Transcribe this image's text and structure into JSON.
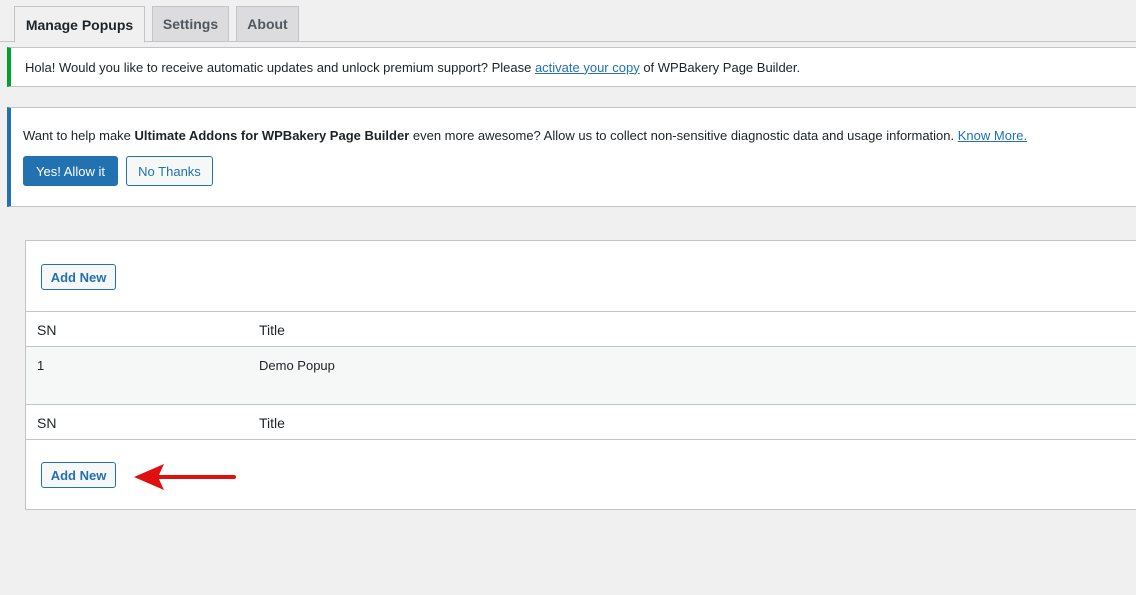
{
  "tabs": [
    {
      "label": "Manage Popups",
      "active": true
    },
    {
      "label": "Settings",
      "active": false
    },
    {
      "label": "About",
      "active": false
    }
  ],
  "update_notice": {
    "text_before": "Hola! Would you like to receive automatic updates and unlock premium support? Please ",
    "link_text": "activate your copy",
    "text_after": " of WPBakery Page Builder."
  },
  "optin_notice": {
    "text_before": "Want to help make ",
    "bold_text": "Ultimate Addons for WPBakery Page Builder",
    "text_after": " even more awesome? Allow us to collect non-sensitive diagnostic data and usage information. ",
    "link_text": "Know More.",
    "allow_label": "Yes! Allow it",
    "decline_label": "No Thanks"
  },
  "popups_table": {
    "add_new_label": "Add New",
    "columns": [
      "SN",
      "Title"
    ],
    "rows": [
      {
        "sn": "1",
        "title": "Demo Popup"
      }
    ]
  },
  "colors": {
    "accent": "#2271b1",
    "success": "#00a32a",
    "annotation_arrow": "#e01010"
  }
}
